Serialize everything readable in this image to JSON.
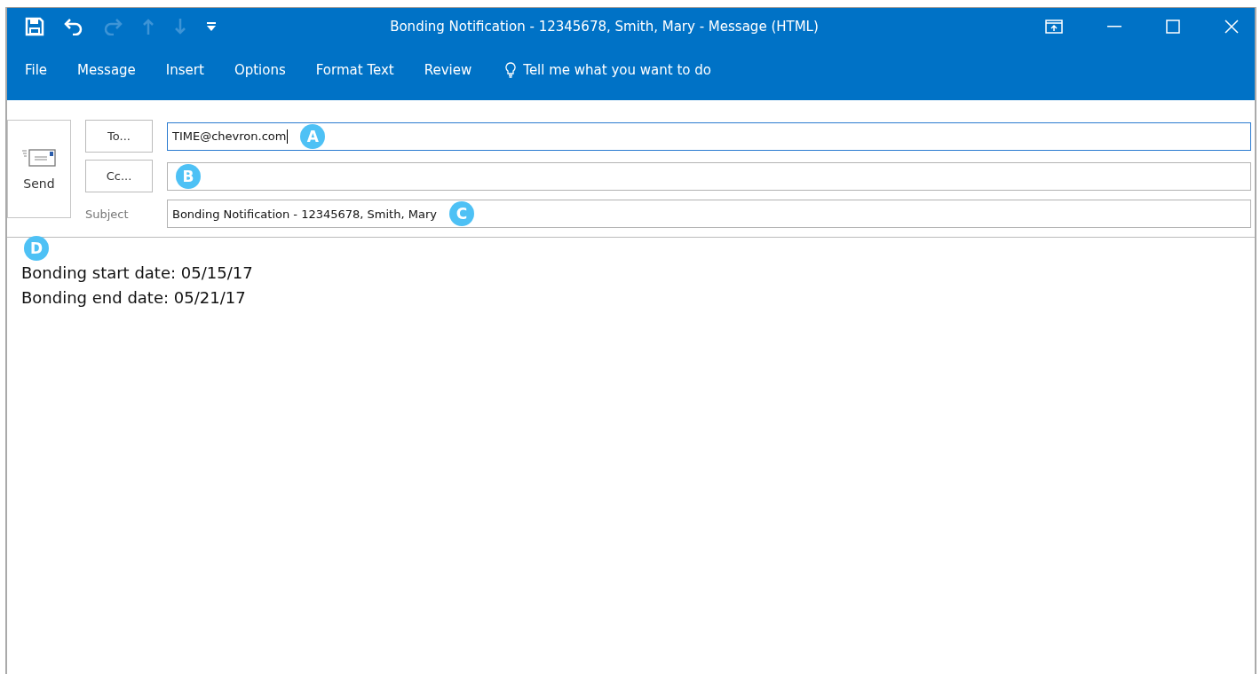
{
  "window": {
    "title": "Bonding Notification - 12345678, Smith, Mary - Message (HTML)"
  },
  "quick_access": [
    {
      "kind": "save",
      "disabled": false
    },
    {
      "kind": "undo",
      "disabled": false
    },
    {
      "kind": "redo",
      "disabled": true
    },
    {
      "kind": "up",
      "disabled": true
    },
    {
      "kind": "down",
      "disabled": true
    },
    {
      "kind": "customize",
      "disabled": false
    }
  ],
  "menu": [
    "File",
    "Message",
    "Insert",
    "Options",
    "Format Text",
    "Review"
  ],
  "tell_me": "Tell me what you want to do",
  "send": {
    "label": "Send"
  },
  "fields": [
    {
      "kind": "button",
      "label": "To...",
      "value": "TIME@chevron.com",
      "focused": true,
      "callout": "A"
    },
    {
      "kind": "button",
      "label": "Cc...",
      "focused": false,
      "callout": "B"
    },
    {
      "kind": "label",
      "label": "Subject",
      "value": "Bonding Notification - 12345678, Smith, Mary",
      "focused": false,
      "callout": "C"
    }
  ],
  "body": {
    "callout": "D",
    "lines": [
      "Bonding start date: 05/15/17",
      "Bonding end date: 05/21/17"
    ]
  }
}
